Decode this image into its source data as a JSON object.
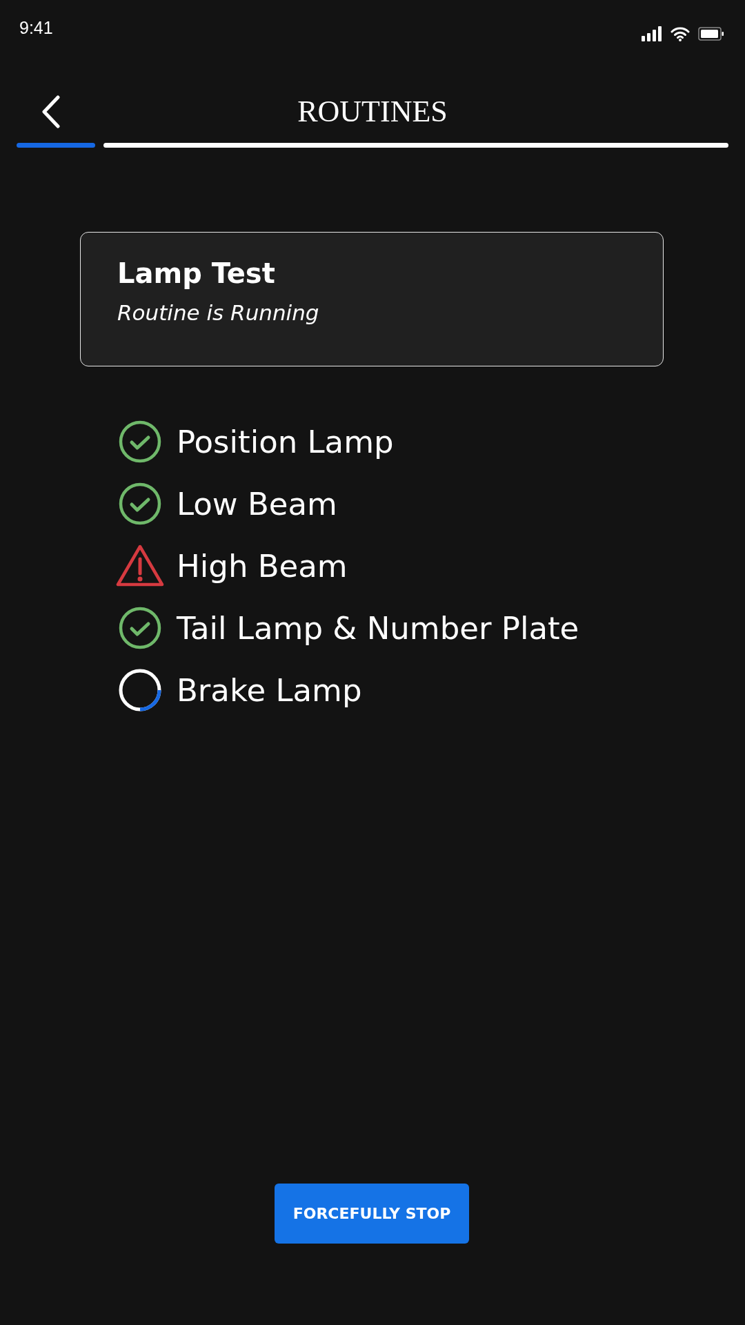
{
  "status_bar": {
    "time": "9:41"
  },
  "header": {
    "title": "ROUTINES",
    "progress": {
      "level": 0.11
    }
  },
  "routine": {
    "name": "Lamp Test",
    "status": "Routine is Running"
  },
  "checks": [
    {
      "label": "Position Lamp",
      "kind": "passed"
    },
    {
      "label": "Low Beam",
      "kind": "passed"
    },
    {
      "label": "High Beam",
      "kind": "warning"
    },
    {
      "label": "Tail Lamp & Number Plate",
      "kind": "passed"
    },
    {
      "label": "Brake Lamp",
      "kind": "running"
    }
  ],
  "stop_button": {
    "label": "FORCEFULLY STOP"
  }
}
